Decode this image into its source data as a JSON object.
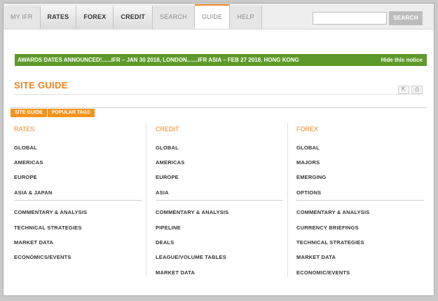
{
  "nav": {
    "tabs": [
      {
        "label": "MY IFR",
        "style": "muted"
      },
      {
        "label": "RATES",
        "style": "normal"
      },
      {
        "label": "FOREX",
        "style": "normal"
      },
      {
        "label": "CREDIT",
        "style": "normal"
      },
      {
        "label": "SEARCH",
        "style": "muted"
      },
      {
        "label": "GUIDE",
        "style": "active"
      },
      {
        "label": "HELP",
        "style": "muted"
      }
    ],
    "search_value": "",
    "search_button": "SEARCH"
  },
  "notice": {
    "text": "AWARDS DATES ANNOUNCED!......IFR – JAN 30 2018, LONDON.......IFR ASIA – FEB 27 2018, HONG KONG",
    "hide_label": "Hide this notice",
    "color": "#5e9a2b"
  },
  "page": {
    "title": "SITE GUIDE",
    "accent": "#f0821e",
    "subtabs": [
      "SITE GUIDE",
      "POPULAR TAGS"
    ]
  },
  "columns": [
    {
      "heading": "RATES",
      "group1": [
        "GLOBAL",
        "AMERICAS",
        "EUROPE",
        "ASIA & JAPAN"
      ],
      "group2": [
        "COMMENTARY & ANALYSIS",
        "TECHNICAL STRATEGIES",
        "MARKET DATA",
        "ECONOMICS/EVENTS"
      ]
    },
    {
      "heading": "CREDIT",
      "group1": [
        "GLOBAL",
        "AMERICAS",
        "EUROPE",
        "ASIA"
      ],
      "group2": [
        "COMMENTARY & ANALYSIS",
        "PIPELINE",
        "DEALS",
        "LEAGUE/VOLUME TABLES",
        "MARKET DATA"
      ]
    },
    {
      "heading": "FOREX",
      "group1": [
        "GLOBAL",
        "MAJORS",
        "EMERGING",
        "OPTIONS"
      ],
      "group2": [
        "COMMENTARY & ANALYSIS",
        "CURRENCY BRIEFINGS",
        "TECHNICAL STRATEGIES",
        "MARKET DATA",
        "ECONOMIC/EVENTS"
      ]
    }
  ]
}
